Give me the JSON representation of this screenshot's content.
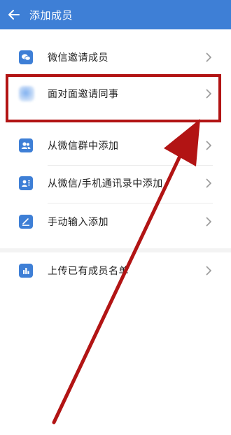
{
  "header": {
    "title": "添加成员",
    "back_icon": "arrow-left-icon"
  },
  "items": [
    {
      "label": "微信邀请成员",
      "icon": "wechat-icon"
    },
    {
      "label": "面对面邀请同事",
      "icon": "blurred-app-icon"
    },
    {
      "label": "从微信群中添加",
      "icon": "group-icon"
    },
    {
      "label": "从微信/手机通讯录中添加",
      "icon": "contacts-icon"
    },
    {
      "label": "手动输入添加",
      "icon": "pencil-icon"
    },
    {
      "label": "上传已有成员名单",
      "icon": "chart-file-icon"
    }
  ],
  "colors": {
    "accent": "#3e7fd6",
    "annotation": "#b21414"
  }
}
